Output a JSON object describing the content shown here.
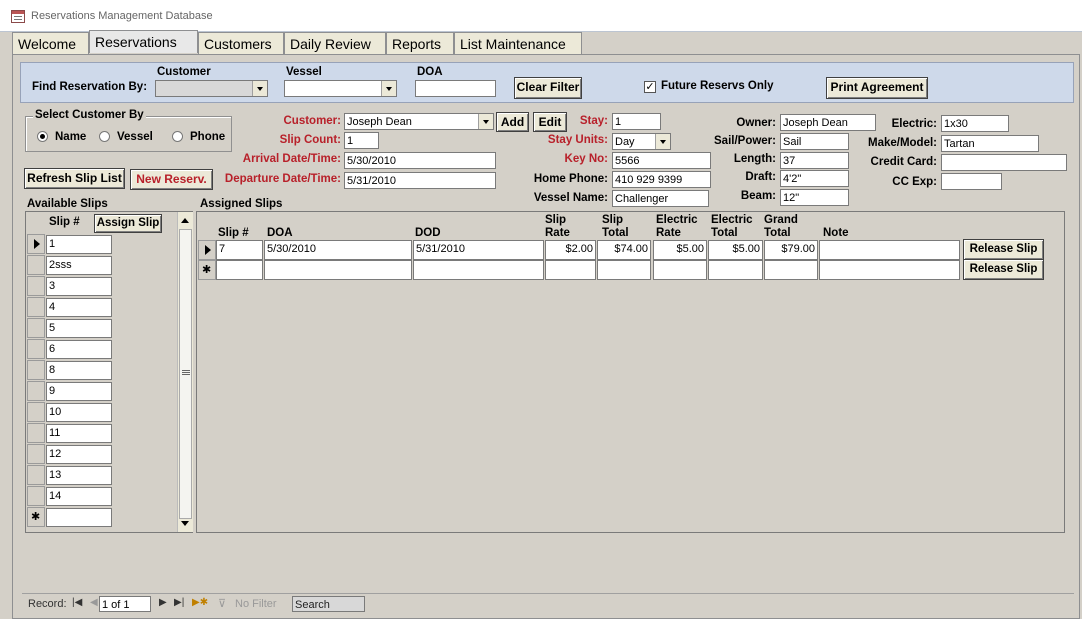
{
  "window": {
    "title": "Reservations Management Database"
  },
  "tabs": [
    {
      "label": "Welcome"
    },
    {
      "label": "Reservations"
    },
    {
      "label": "Customers"
    },
    {
      "label": "Daily Review"
    },
    {
      "label": "Reports"
    },
    {
      "label": "List Maintenance"
    }
  ],
  "find": {
    "label": "Find Reservation By:",
    "customer_label": "Customer",
    "customer_value": "",
    "vessel_label": "Vessel",
    "vessel_value": "",
    "doa_label": "DOA",
    "doa_value": "",
    "clear_filter": "Clear Filter",
    "future_label": "Future Reservs Only",
    "future_checked": true,
    "print_agreement": "Print Agreement"
  },
  "select_customer": {
    "title": "Select Customer By",
    "options": [
      "Name",
      "Vessel",
      "Phone"
    ],
    "selected": "Name"
  },
  "buttons": {
    "refresh_slip_list": "Refresh Slip List",
    "new_reserv": "New Reserv.",
    "add": "Add",
    "edit": "Edit",
    "assign_slip": "Assign Slip",
    "release_slip": "Release Slip"
  },
  "reservation": {
    "customer_label": "Customer:",
    "customer_value": "Joseph Dean",
    "slip_count_label": "Slip Count:",
    "slip_count_value": "1",
    "arrival_label": "Arrival Date/Time:",
    "arrival_value": "5/30/2010",
    "departure_label": "Departure Date/Time:",
    "departure_value": "5/31/2010",
    "stay_label": "Stay:",
    "stay_value": "1",
    "stay_units_label": "Stay Units:",
    "stay_units_value": "Day",
    "key_no_label": "Key No:",
    "key_no_value": "5566",
    "home_phone_label": "Home Phone:",
    "home_phone_value": "410 929 9399",
    "vessel_name_label": "Vessel Name:",
    "vessel_name_value": "Challenger",
    "owner_label": "Owner:",
    "owner_value": "Joseph Dean",
    "sail_power_label": "Sail/Power:",
    "sail_power_value": "Sail",
    "length_label": "Length:",
    "length_value": "37",
    "draft_label": "Draft:",
    "draft_value": "4'2\"",
    "beam_label": "Beam:",
    "beam_value": "12\"",
    "electric_label": "Electric:",
    "electric_value": "1x30",
    "make_model_label": "Make/Model:",
    "make_model_value": "Tartan",
    "credit_card_label": "Credit Card:",
    "credit_card_value": "",
    "cc_exp_label": "CC Exp:",
    "cc_exp_value": ""
  },
  "available_slips": {
    "title": "Available Slips",
    "column": "Slip #",
    "rows": [
      "1",
      "2sss",
      "3",
      "4",
      "5",
      "6",
      "8",
      "9",
      "10",
      "11",
      "12",
      "13",
      "14"
    ]
  },
  "assigned_slips": {
    "title": "Assigned Slips",
    "headers": {
      "slip": "Slip #",
      "doa": "DOA",
      "dod": "DOD",
      "slip_rate_1": "Slip",
      "slip_rate_2": "Rate",
      "slip_total_1": "Slip",
      "slip_total_2": "Total",
      "elec_rate_1": "Electric",
      "elec_rate_2": "Rate",
      "elec_total_1": "Electric",
      "elec_total_2": "Total",
      "grand_total_1": "Grand",
      "grand_total_2": "Total",
      "note": "Note"
    },
    "rows": [
      {
        "slip": "7",
        "doa": "5/30/2010",
        "dod": "5/31/2010",
        "slip_rate": "$2.00",
        "slip_total": "$74.00",
        "elec_rate": "$5.00",
        "elec_total": "$5.00",
        "grand_total": "$79.00",
        "note": ""
      }
    ]
  },
  "statusbar": {
    "record_label": "Record:",
    "record_value": "1 of 1",
    "no_filter": "No Filter",
    "search": "Search"
  }
}
